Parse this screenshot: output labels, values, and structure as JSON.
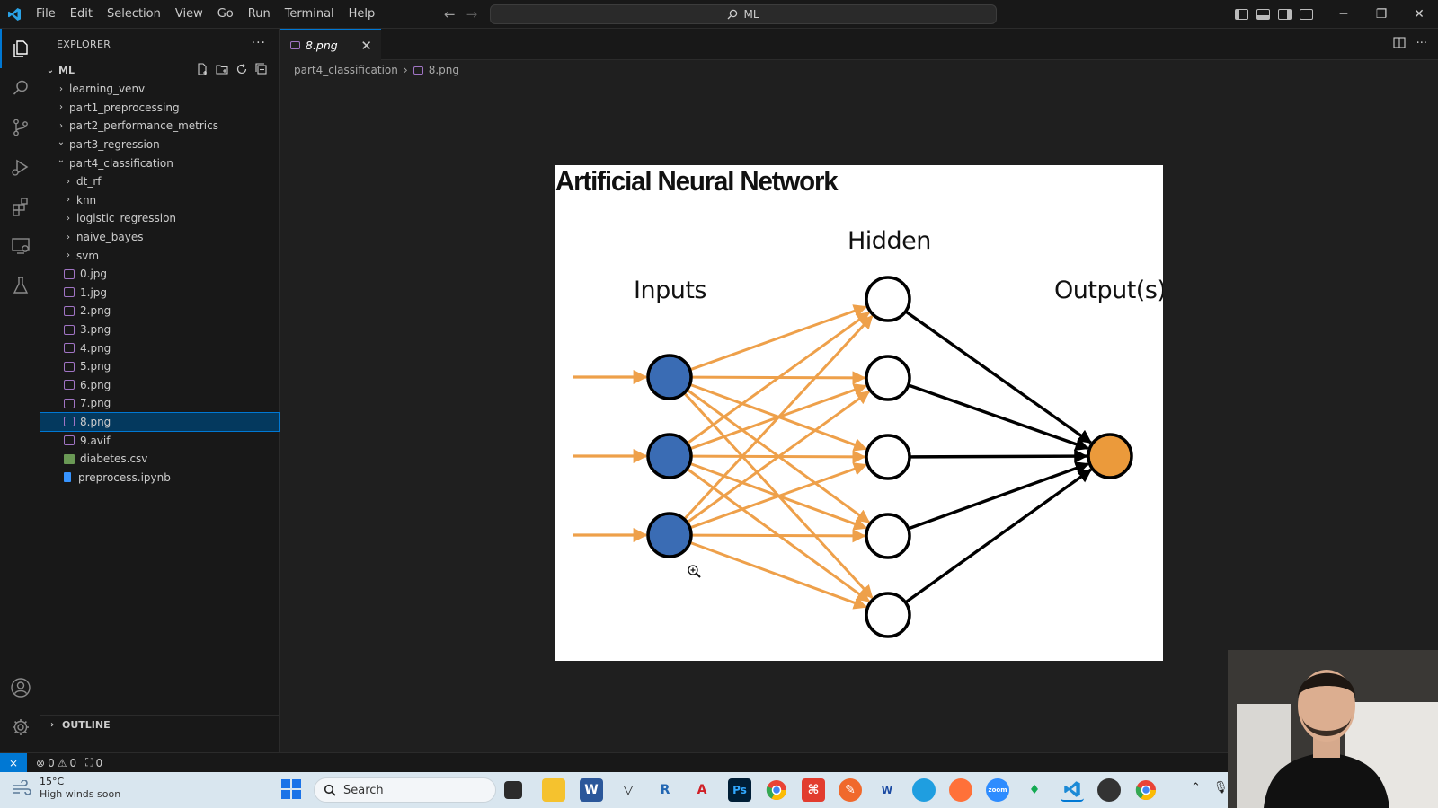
{
  "menu": [
    "File",
    "Edit",
    "Selection",
    "View",
    "Go",
    "Run",
    "Terminal",
    "Help"
  ],
  "command_center": "ML",
  "explorer": {
    "header": "EXPLORER",
    "workspace": "ML",
    "tree": [
      {
        "label": "learning_venv",
        "kind": "folder",
        "open": false,
        "depth": 0
      },
      {
        "label": "part1_preprocessing",
        "kind": "folder",
        "open": false,
        "depth": 0
      },
      {
        "label": "part2_performance_metrics",
        "kind": "folder",
        "open": false,
        "depth": 0
      },
      {
        "label": "part3_regression",
        "kind": "folder",
        "open": true,
        "depth": 0
      },
      {
        "label": "part4_classification",
        "kind": "folder",
        "open": true,
        "depth": 0
      },
      {
        "label": "dt_rf",
        "kind": "folder",
        "open": false,
        "depth": 1
      },
      {
        "label": "knn",
        "kind": "folder",
        "open": false,
        "depth": 1
      },
      {
        "label": "logistic_regression",
        "kind": "folder",
        "open": false,
        "depth": 1
      },
      {
        "label": "naive_bayes",
        "kind": "folder",
        "open": false,
        "depth": 1
      },
      {
        "label": "svm",
        "kind": "folder",
        "open": false,
        "depth": 1
      },
      {
        "label": "0.jpg",
        "kind": "image",
        "depth": 1
      },
      {
        "label": "1.jpg",
        "kind": "image",
        "depth": 1
      },
      {
        "label": "2.png",
        "kind": "image",
        "depth": 1
      },
      {
        "label": "3.png",
        "kind": "image",
        "depth": 1
      },
      {
        "label": "4.png",
        "kind": "image",
        "depth": 1
      },
      {
        "label": "5.png",
        "kind": "image",
        "depth": 1
      },
      {
        "label": "6.png",
        "kind": "image",
        "depth": 1
      },
      {
        "label": "7.png",
        "kind": "image",
        "depth": 1
      },
      {
        "label": "8.png",
        "kind": "image",
        "depth": 1,
        "selected": true
      },
      {
        "label": "9.avif",
        "kind": "image",
        "depth": 1
      },
      {
        "label": "diabetes.csv",
        "kind": "csv",
        "depth": 1
      },
      {
        "label": "preprocess.ipynb",
        "kind": "notebook",
        "depth": 1
      }
    ],
    "outline": "OUTLINE"
  },
  "editor": {
    "tab_label": "8.png",
    "breadcrumb": [
      "part4_classification",
      "8.png"
    ]
  },
  "diagram": {
    "title": "Artificial Neural Network",
    "label_inputs": "Inputs",
    "label_hidden": "Hidden",
    "label_outputs": "Output(s)",
    "input_color": "#3a6cb4",
    "output_color": "#eb9a3b",
    "edge_color": "#eea04a",
    "input_nodes": 3,
    "hidden_nodes": 5,
    "output_nodes": 1
  },
  "status": {
    "errors": "0",
    "warnings": "0",
    "ports": "0"
  },
  "taskbar": {
    "temperature": "15°C",
    "weather_note": "High winds soon",
    "search_placeholder": "Search"
  }
}
